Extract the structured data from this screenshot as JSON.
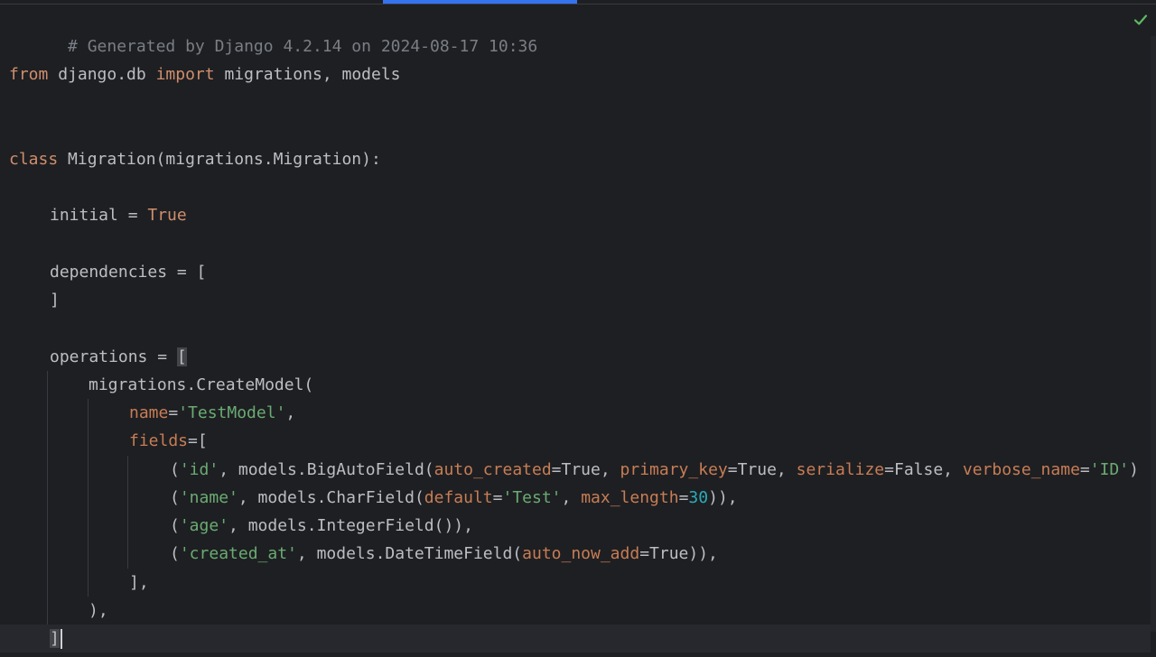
{
  "editor": {
    "status_icon": "check-icon",
    "accent_color": "#3574f0",
    "status_color": "#5fb865"
  },
  "code": {
    "header_comment": "# Generated by Django 4.2.14 on 2024-08-17 10:36",
    "import_line": {
      "kw_from": "from",
      "module": " django.db ",
      "kw_import": "import",
      "names": " migrations, models"
    },
    "class_line": {
      "kw_class": "class",
      "rest": " Migration(migrations.Migration):"
    },
    "initial_line": {
      "name": "initial = ",
      "value": "True"
    },
    "dependencies_open": "dependencies = [",
    "dependencies_close": "]",
    "operations_prefix": "operations = ",
    "operations_open": "[",
    "create_model": "migrations.CreateModel(",
    "name_kw": "name",
    "name_eq": "=",
    "name_value": "'TestModel'",
    "name_comma": ",",
    "fields_kw": "fields",
    "fields_open": "=[",
    "field_id": {
      "open": "(",
      "name": "'id'",
      "call": ", models.BigAutoField(",
      "p1": "auto_created",
      "v1": "=True, ",
      "p2": "primary_key",
      "v2": "=True, ",
      "p3": "serialize",
      "v3": "=False, ",
      "p4": "verbose_name",
      "eq4": "=",
      "v4": "'ID'",
      "close": ")"
    },
    "field_name": {
      "open": "(",
      "name": "'name'",
      "call": ", models.CharField(",
      "p1": "default",
      "eq1": "=",
      "v1": "'Test'",
      "sep": ", ",
      "p2": "max_length",
      "eq2": "=",
      "v2": "30",
      "close": ")),"
    },
    "field_age": {
      "open": "(",
      "name": "'age'",
      "call": ", models.IntegerField()),"
    },
    "field_created": {
      "open": "(",
      "name": "'created_at'",
      "call": ", models.DateTimeField(",
      "p1": "auto_now_add",
      "v1": "=True)),"
    },
    "fields_close": "],",
    "create_close": "),",
    "operations_close": "]"
  }
}
